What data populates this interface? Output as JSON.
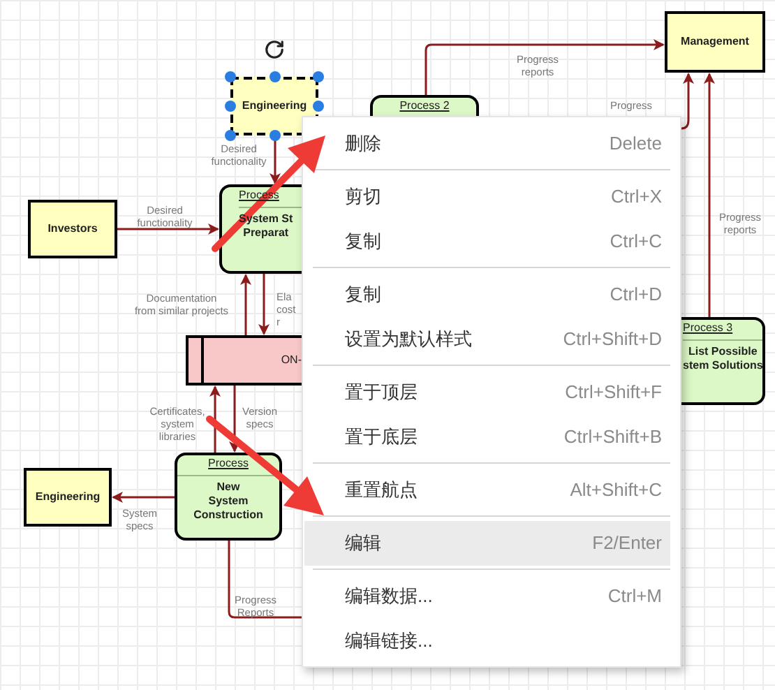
{
  "diagram": {
    "nodes": [
      {
        "kind": "entity",
        "label": "Engineering",
        "selected": true
      },
      {
        "kind": "process",
        "title": "Process 2"
      },
      {
        "kind": "entity",
        "label": "Management",
        "selected": false
      },
      {
        "kind": "entity",
        "label": "Investors",
        "selected": false
      },
      {
        "kind": "process",
        "title": "Process",
        "body": [
          "System St",
          "Preparat"
        ]
      },
      {
        "kind": "store",
        "label": "ON-"
      },
      {
        "kind": "process",
        "title": "Process 3",
        "body": [
          "List Possible",
          "stem Solutions"
        ]
      },
      {
        "kind": "entity",
        "label": "Engineering",
        "selected": false
      },
      {
        "kind": "process",
        "title": "Process",
        "body": [
          "New",
          "System",
          "Construction"
        ]
      }
    ],
    "labels": [
      "Desired\nfunctionality",
      "Desired\nfunctionality",
      "Progress\nreports",
      "Progress",
      "Documentation\nfrom similar projects",
      "Ela\ncost\nr",
      "Certificates,\nsystem\nlibraries",
      "Version\nspecs",
      "System\nspecs",
      "Progress\nReports",
      "Progress\nreports"
    ]
  },
  "context_menu": {
    "groups": [
      [
        {
          "label": "删除",
          "shortcut": "Delete",
          "selected": false
        }
      ],
      [
        {
          "label": "剪切",
          "shortcut": "Ctrl+X",
          "selected": false
        },
        {
          "label": "复制",
          "shortcut": "Ctrl+C",
          "selected": false
        }
      ],
      [
        {
          "label": "复制",
          "shortcut": "Ctrl+D",
          "selected": false
        },
        {
          "label": "设置为默认样式",
          "shortcut": "Ctrl+Shift+D",
          "selected": false
        }
      ],
      [
        {
          "label": "置于顶层",
          "shortcut": "Ctrl+Shift+F",
          "selected": false
        },
        {
          "label": "置于底层",
          "shortcut": "Ctrl+Shift+B",
          "selected": false
        }
      ],
      [
        {
          "label": "重置航点",
          "shortcut": "Alt+Shift+C",
          "selected": false
        }
      ],
      [
        {
          "label": "编辑",
          "shortcut": "F2/Enter",
          "selected": true
        }
      ],
      [
        {
          "label": "编辑数据...",
          "shortcut": "Ctrl+M",
          "selected": false
        },
        {
          "label": "编辑链接...",
          "selected": false
        }
      ]
    ]
  }
}
